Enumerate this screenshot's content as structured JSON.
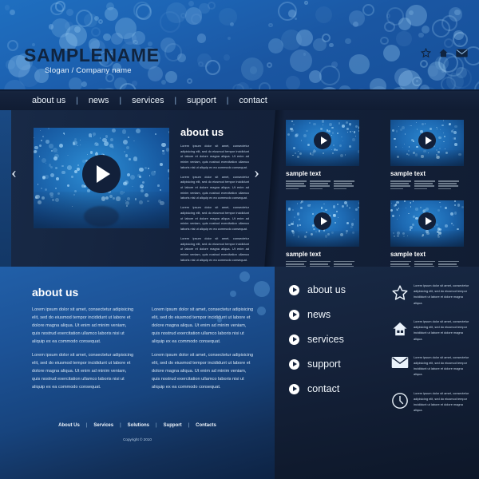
{
  "header": {
    "logo": "SAMPLENAME",
    "slogan": "Slogan / Company name",
    "icons": [
      "star-icon",
      "home-icon",
      "envelope-icon"
    ]
  },
  "nav": {
    "items": [
      {
        "label": "about us"
      },
      {
        "label": "news"
      },
      {
        "label": "services"
      },
      {
        "label": "support"
      },
      {
        "label": "contact"
      }
    ],
    "separator": "|"
  },
  "slider": {
    "prev_arrow": "‹",
    "next_arrow": "›",
    "play_button": "play-icon",
    "title": "about us",
    "paragraphs": [
      "Lorem ipsum dolor sit amet, consectetur adipisicing elit, sed do eiusmod tempor incididunt ut labore et dolore magna aliqua. Ut enim ad minim veniam, quis nostrud exercitation ullamco laboris nisi ut aliquip ex ea commodo consequat.",
      "Lorem ipsum dolor sit amet, consectetur adipisicing elit, sed do eiusmod tempor incididunt ut labore et dolore magna aliqua. Ut enim ad minim veniam, quis nostrud exercitation ullamco laboris nisi ut aliquip ex ea commodo consequat.",
      "Lorem ipsum dolor sit amet, consectetur adipisicing elit, sed do eiusmod tempor incididunt ut labore et dolore magna aliqua. Ut enim ad minim veniam, quis nostrud exercitation ullamco laboris nisi ut aliquip ex ea commodo consequat.",
      "Lorem ipsum dolor sit amet, consectetur adipisicing elit, sed do eiusmod tempor incididunt ut labore et dolore magna aliqua. Ut enim ad minim veniam, quis nostrud exercitation ullamco laboris nisi ut aliquip ex ea commodo consequat."
    ]
  },
  "thumbnails": [
    {
      "label": "sample text"
    },
    {
      "label": "sample text"
    },
    {
      "label": "sample text"
    },
    {
      "label": "sample text"
    }
  ],
  "about_section": {
    "title": "about us",
    "columns": [
      [
        "Lorem ipsum dolor sit amet, consectetur adipisicing elit, sed do eiusmod tempor incididunt ut labore et dolore magna aliqua. Ut enim ad minim veniam, quis nostrud exercitation ullamco laboris nisi ut aliquip ex ea commodo consequat.",
        "Lorem ipsum dolor sit amet, consectetur adipisicing elit, sed do eiusmod tempor incididunt ut labore et dolore magna aliqua. Ut enim ad minim veniam, quis nostrud exercitation ullamco laboris nisi ut aliquip ex ea commodo consequat."
      ],
      [
        "Lorem ipsum dolor sit amet, consectetur adipisicing elit, sed do eiusmod tempor incididunt ut labore et dolore magna aliqua. Ut enim ad minim veniam, quis nostrud exercitation ullamco laboris nisi ut aliquip ex ea commodo consequat.",
        "Lorem ipsum dolor sit amet, consectetur adipisicing elit, sed do eiusmod tempor incididunt ut labore et dolore magna aliqua. Ut enim ad minim veniam, quis nostrud exercitation ullamco laboris nisi ut aliquip ex ea commodo consequat."
      ]
    ]
  },
  "footer": {
    "links": [
      {
        "label": "About Us"
      },
      {
        "label": "Services"
      },
      {
        "label": "Solutions"
      },
      {
        "label": "Support"
      },
      {
        "label": "Contacts"
      }
    ],
    "separator": "|",
    "copyright": "Copyright © 2010"
  },
  "side_menu": {
    "items": [
      {
        "label": "about us"
      },
      {
        "label": "news"
      },
      {
        "label": "services"
      },
      {
        "label": "support"
      },
      {
        "label": "contact"
      }
    ]
  },
  "feature_list": [
    {
      "icon": "star-icon",
      "text": "Lorem ipsum dolor sit amet, consectetur adipisicing elit, sed do eiusmod tempor incididunt ut labore et dolore magna aliqua."
    },
    {
      "icon": "home-icon",
      "text": "Lorem ipsum dolor sit amet, consectetur adipisicing elit, sed do eiusmod tempor incididunt ut labore et dolore magna aliqua."
    },
    {
      "icon": "envelope-icon",
      "text": "Lorem ipsum dolor sit amet, consectetur adipisicing elit, sed do eiusmod tempor incididunt ut labore et dolore magna aliqua."
    },
    {
      "icon": "clock-icon",
      "text": "Lorem ipsum dolor sit amet, consectetur adipisicing elit, sed do eiusmod tempor incididunt ut labore et dolore magna aliqua."
    }
  ],
  "colors": {
    "header_blue": "#1d64b4",
    "nav_dark": "#131f37",
    "panel_blue": "#1c5296",
    "dark_panel": "#142139",
    "accent_white": "#ffffff",
    "logo_navy": "#10243f"
  }
}
